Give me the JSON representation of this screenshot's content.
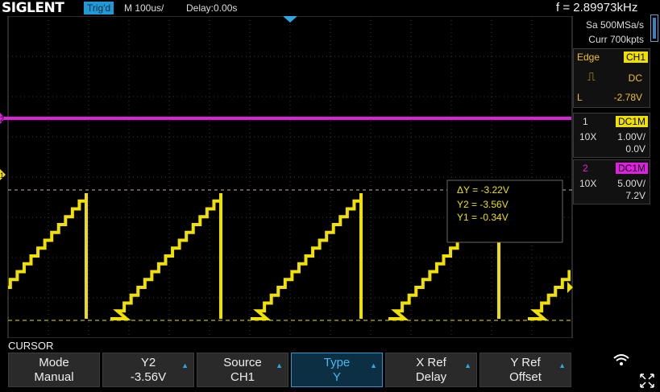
{
  "header": {
    "brand": "SIGLENT",
    "trigger_status": "Trig'd",
    "timebase": "M 100us/",
    "delay": "Delay:0.00s",
    "frequency": "f = 2.89973kHz"
  },
  "acquisition": {
    "sample_rate": "Sa 500MSa/s",
    "memory": "Curr 700kpts"
  },
  "trigger": {
    "type": "Edge",
    "source": "CH1",
    "coupling": "DC",
    "level_label": "L",
    "level": "-2.78V"
  },
  "channels": [
    {
      "number": "1",
      "coupling": "DC1M",
      "probe": "10X",
      "scale": "1.00V/",
      "offset": "0.0V",
      "color": "#f5f000"
    },
    {
      "number": "2",
      "coupling": "DC1M",
      "probe": "10X",
      "scale": "5.00V/",
      "offset": "7.2V",
      "color": "#e020e0"
    }
  ],
  "cursor_readout": {
    "delta_y": "ΔY = -3.22V",
    "y2": "Y2 = -3.56V",
    "y1": "Y1 = -0.34V"
  },
  "markers": {
    "ch1_marker": "1",
    "ch2_marker": "2"
  },
  "menu": {
    "title": "CURSOR",
    "buttons": [
      {
        "top": "Mode",
        "bottom": "Manual",
        "arrow": false
      },
      {
        "top": "Y2",
        "bottom": "-3.56V",
        "arrow": true
      },
      {
        "top": "Source",
        "bottom": "CH1",
        "arrow": true
      },
      {
        "top": "Type",
        "bottom": "Y",
        "arrow": true,
        "selected": true
      },
      {
        "top": "X Ref",
        "bottom": "Delay",
        "arrow": true
      },
      {
        "top": "Y Ref",
        "bottom": "Offset",
        "arrow": true
      }
    ]
  },
  "icons": {
    "wifi": "wifi-icon",
    "fullscreen": "fullscreen-icon",
    "arrow": "up-arrow-icon"
  }
}
